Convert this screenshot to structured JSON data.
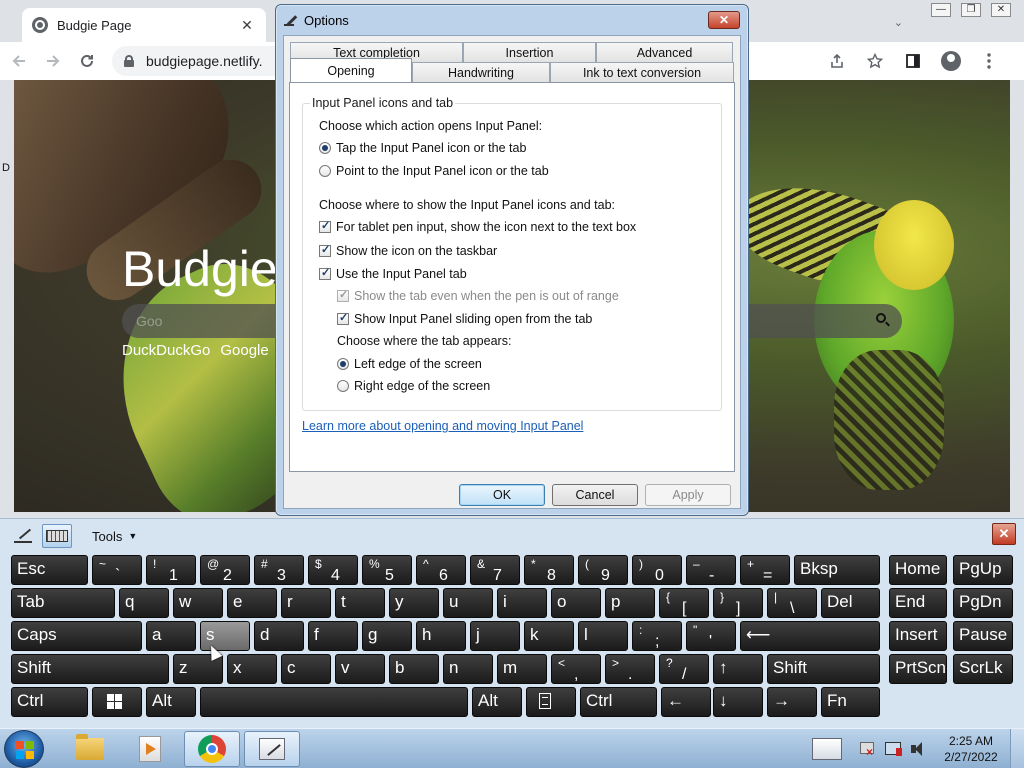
{
  "browser": {
    "tab_title": "Budgie Page",
    "tab_close": "✕",
    "url": "budgiepage.netlify.",
    "window_controls": [
      "—",
      "❐",
      "✕"
    ],
    "tab_dropdown": "⌄"
  },
  "page": {
    "title": "Budgie",
    "search_placeholder": "Goo",
    "engines": [
      "DuckDuckGo",
      "Google"
    ]
  },
  "side_letter": "D",
  "dialog": {
    "title": "Options",
    "close_label": "✕",
    "tabs_row1": [
      "Text completion",
      "Insertion",
      "Advanced"
    ],
    "tabs_row2": [
      "Opening",
      "Handwriting",
      "Ink to text conversion"
    ],
    "active_tab": "Opening",
    "group_label": "Input Panel icons and tab",
    "action_heading": "Choose which action opens Input Panel:",
    "radio_tap": "Tap the Input Panel icon or the tab",
    "radio_point": "Point to the Input Panel icon or the tab",
    "where_heading": "Choose where to show the Input Panel icons and tab:",
    "chk_tablet_pen": "For tablet pen input, show the icon next to the text box",
    "chk_taskbar": "Show the icon on the taskbar",
    "chk_use_tab": "Use the Input Panel tab",
    "chk_show_out_of_range": "Show the tab even when the pen is out of range",
    "chk_sliding": "Show Input Panel sliding open from the tab",
    "tab_appears_heading": "Choose where the tab appears:",
    "radio_left": "Left edge of the screen",
    "radio_right": "Right edge of the screen",
    "learn_more": "Learn more about opening and moving Input Panel",
    "ok": "OK",
    "cancel": "Cancel",
    "apply": "Apply"
  },
  "keyboard": {
    "tools_label": "Tools",
    "close_label": "✕",
    "row1": {
      "esc": "Esc",
      "tilde_top": "~",
      "tilde_bot": "`",
      "k1_top": "!",
      "k1_bot": "1",
      "k2_top": "@",
      "k2_bot": "2",
      "k3_top": "#",
      "k3_bot": "3",
      "k4_top": "$",
      "k4_bot": "4",
      "k5_top": "%",
      "k5_bot": "5",
      "k6_top": "^",
      "k6_bot": "6",
      "k7_top": "&",
      "k7_bot": "7",
      "k8_top": "*",
      "k8_bot": "8",
      "k9_top": "(",
      "k9_bot": "9",
      "k0_top": ")",
      "k0_bot": "0",
      "minus_top": "–",
      "minus_bot": "-",
      "plus_top": "+",
      "plus_bot": "=",
      "bksp": "Bksp",
      "home": "Home",
      "pgup": "PgUp"
    },
    "row2": {
      "tab": "Tab",
      "q": "q",
      "w": "w",
      "e": "e",
      "r": "r",
      "t": "t",
      "y": "y",
      "u": "u",
      "i": "i",
      "o": "o",
      "p": "p",
      "lbrace_top": "{",
      "lbrace_bot": "[",
      "rbrace_top": "}",
      "rbrace_bot": "]",
      "pipe_top": "|",
      "pipe_bot": "\\",
      "del": "Del",
      "end": "End",
      "pgdn": "PgDn"
    },
    "row3": {
      "caps": "Caps",
      "a": "a",
      "s": "s",
      "d": "d",
      "f": "f",
      "g": "g",
      "h": "h",
      "j": "j",
      "k": "k",
      "l": "l",
      "colon_top": ":",
      "colon_bot": ";",
      "quote_top": "\"",
      "quote_bot": "'",
      "enter": "⟵",
      "insert": "Insert",
      "pause": "Pause"
    },
    "row4": {
      "shift_l": "Shift",
      "z": "z",
      "x": "x",
      "c": "c",
      "v": "v",
      "b": "b",
      "n": "n",
      "m": "m",
      "lt_top": "<",
      "lt_bot": ",",
      "gt_top": ">",
      "gt_bot": ".",
      "q_top": "?",
      "q_bot": "/",
      "up": "↑",
      "shift_r": "Shift",
      "prtscn": "PrtScn",
      "scrlk": "ScrLk"
    },
    "row5": {
      "ctrl_l": "Ctrl",
      "alt_l": "Alt",
      "alt_r": "Alt",
      "ctrl_r": "Ctrl",
      "left": "←",
      "down": "↓",
      "right": "→",
      "fn": "Fn"
    }
  },
  "taskbar": {
    "time": "2:25 AM",
    "date": "2/27/2022"
  }
}
